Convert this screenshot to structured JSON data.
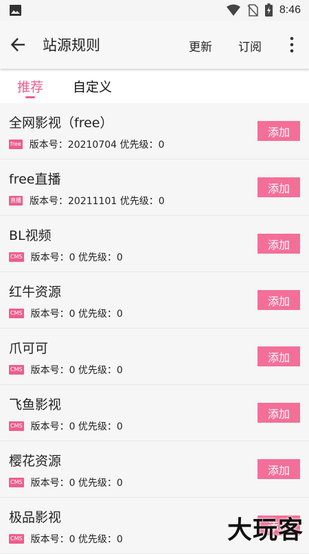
{
  "status_bar": {
    "time": "8:46",
    "icons": [
      "image-icon",
      "wifi-icon",
      "no-sim-icon",
      "battery-charging-icon"
    ]
  },
  "appbar": {
    "title": "站源规则",
    "update_label": "更新",
    "subscribe_label": "订阅"
  },
  "tabs": [
    {
      "label": "推荐",
      "active": true
    },
    {
      "label": "自定义",
      "active": false
    }
  ],
  "sources": [
    {
      "name": "全网影视（free）",
      "badge": "free",
      "meta": "版本号：20210704  优先级：0",
      "button": "添加"
    },
    {
      "name": "free直播",
      "badge": "直播",
      "meta": "版本号：20211101  优先级：0",
      "button": "添加"
    },
    {
      "name": "BL视频",
      "badge": "CMS",
      "meta": "版本号：0  优先级：0",
      "button": "添加"
    },
    {
      "name": "红牛资源",
      "badge": "CMS",
      "meta": "版本号：0  优先级：0",
      "button": "添加"
    },
    {
      "name": "爪可可",
      "badge": "CMS",
      "meta": "版本号：0  优先级：0",
      "button": "添加"
    },
    {
      "name": "飞鱼影视",
      "badge": "CMS",
      "meta": "版本号：0  优先级：0",
      "button": "添加"
    },
    {
      "name": "樱花资源",
      "badge": "CMS",
      "meta": "版本号：0  优先级：0",
      "button": "添加"
    },
    {
      "name": "极品影视",
      "badge": "CMS",
      "meta": "版本号：0  优先级：0",
      "button": "添加"
    }
  ],
  "watermark": "大玩客",
  "colors": {
    "accent": "#ee5d8e",
    "button": "#f36f98"
  }
}
